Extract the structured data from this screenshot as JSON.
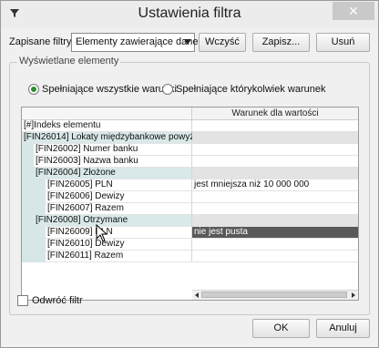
{
  "window": {
    "title": "Ustawienia filtra",
    "close_glyph": "✕"
  },
  "toolbar": {
    "saved_filters_label": "Zapisane filtry",
    "saved_filters_value": "Elementy zawierające dane",
    "choose_label": "Wczyść",
    "save_label": "Zapisz...",
    "delete_label": "Usuń"
  },
  "group": {
    "title": "Wyświetlane elementy",
    "radio_all_label": "Spełniające wszystkie warunki",
    "radio_any_label": "Spełniające którykolwiek warunek",
    "selected_radio": "all"
  },
  "grid": {
    "column_header": "Warunek dla wartości",
    "rows": [
      {
        "label": "[#]Indeks elementu",
        "level": 0,
        "group": false,
        "condition": ""
      },
      {
        "label": "[FIN26014] Lokaty międzybankowe powyż...",
        "level": 0,
        "group": true,
        "condition": ""
      },
      {
        "label": "[FIN26002] Numer banku",
        "level": 1,
        "group": false,
        "condition": ""
      },
      {
        "label": "[FIN26003] Nazwa banku",
        "level": 1,
        "group": false,
        "condition": ""
      },
      {
        "label": "[FIN26004] Złożone",
        "level": 1,
        "group": true,
        "condition": ""
      },
      {
        "label": "[FIN26005] PLN",
        "level": 2,
        "group": false,
        "condition": "jest mniejsza niż 10 000 000"
      },
      {
        "label": "[FIN26006] Dewizy",
        "level": 2,
        "group": false,
        "condition": ""
      },
      {
        "label": "[FIN26007] Razem",
        "level": 2,
        "group": false,
        "condition": ""
      },
      {
        "label": "[FIN26008] Otrzymane",
        "level": 1,
        "group": true,
        "condition": ""
      },
      {
        "label": "[FIN26009] PLN",
        "level": 2,
        "group": false,
        "condition": "nie jest pusta",
        "selected": true
      },
      {
        "label": "[FIN26010] Dewizy",
        "level": 2,
        "group": false,
        "condition": ""
      },
      {
        "label": "[FIN26011] Razem",
        "level": 2,
        "group": false,
        "condition": ""
      }
    ]
  },
  "invert_filter_label": "Odwróć filtr",
  "buttons": {
    "ok_label": "OK",
    "cancel_label": "Anuluj"
  },
  "colors": {
    "radio_checked": "#2f8f2f",
    "selected_condition": "#595959",
    "group_row": "#d9e8e8"
  }
}
